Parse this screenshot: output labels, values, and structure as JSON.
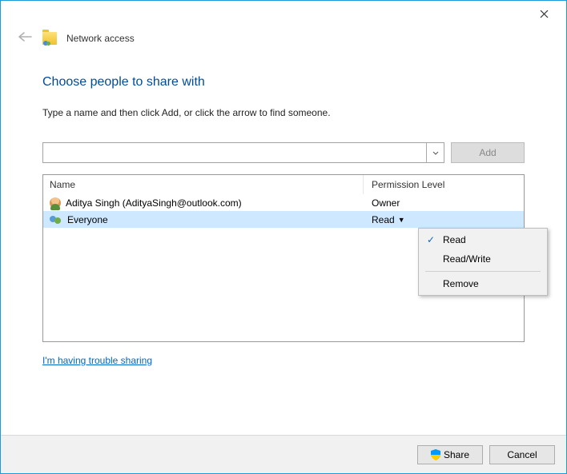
{
  "header": {
    "title": "Network access",
    "heading": "Choose people to share with",
    "instruction": "Type a name and then click Add, or click the arrow to find someone."
  },
  "inputRow": {
    "value": "",
    "placeholder": "",
    "addLabel": "Add"
  },
  "table": {
    "columns": {
      "name": "Name",
      "permission": "Permission Level"
    },
    "rows": [
      {
        "icon": "user",
        "name": "Aditya Singh (AdityaSingh@outlook.com)",
        "permission": "Owner",
        "selected": false,
        "dropdown": false
      },
      {
        "icon": "group",
        "name": "Everyone",
        "permission": "Read",
        "selected": true,
        "dropdown": true
      }
    ]
  },
  "permissionMenu": {
    "items": [
      {
        "label": "Read",
        "checked": true
      },
      {
        "label": "Read/Write",
        "checked": false
      }
    ],
    "removeLabel": "Remove"
  },
  "troubleLink": "I'm having trouble sharing",
  "footer": {
    "share": "Share",
    "cancel": "Cancel"
  }
}
